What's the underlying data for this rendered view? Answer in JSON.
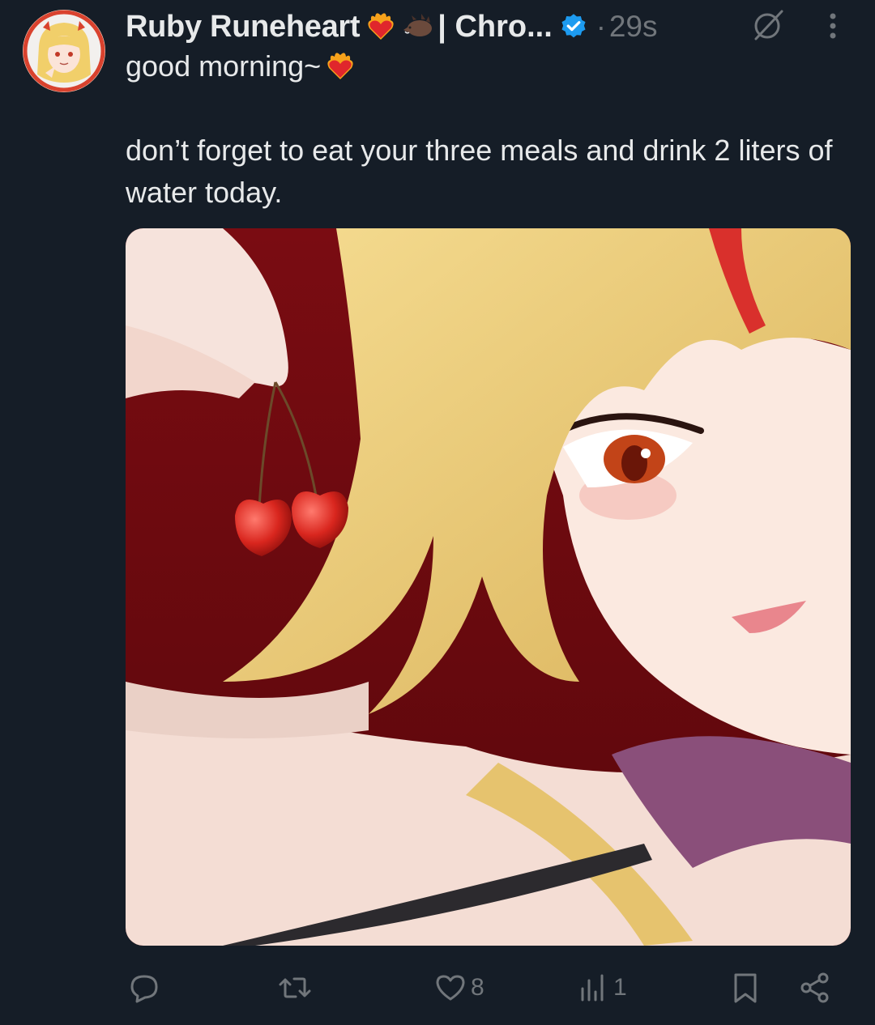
{
  "tweet": {
    "display_name": "Ruby Runeheart",
    "name_suffix": "| Chro...",
    "dot": "·",
    "time": "29s",
    "text_line1": "good morning~",
    "text_line2": "don’t forget to eat your three meals and drink 2 liters of water today."
  },
  "icons": {
    "verified": "verified-badge-icon",
    "grok": "grok-icon",
    "more": "more-icon",
    "reply": "reply-icon",
    "retweet": "retweet-icon",
    "like": "like-icon",
    "views": "views-icon",
    "bookmark": "bookmark-icon",
    "share": "share-icon"
  },
  "actions": {
    "reply_count": "",
    "retweet_count": "",
    "like_count": "8",
    "views_count": "1"
  },
  "colors": {
    "background": "#151d27",
    "text": "#e7e9ea",
    "muted": "#71767b",
    "verified": "#1d9bf0"
  }
}
